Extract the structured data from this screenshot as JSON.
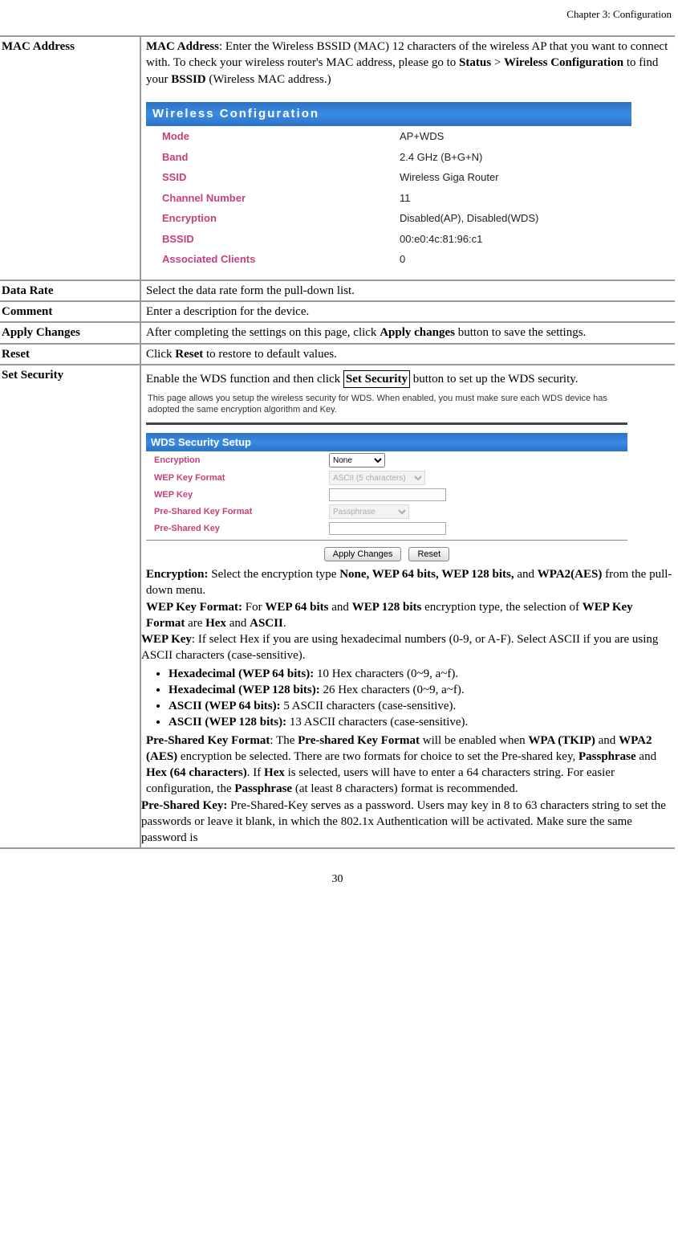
{
  "chapter": "Chapter 3: Configuration",
  "page_number": "30",
  "rows": {
    "mac_address": {
      "label": "MAC Address",
      "desc1a": "MAC Address",
      "desc1b": ": Enter the Wireless BSSID (MAC) 12 characters of the wireless AP that you want to connect with. To check your wireless router's MAC address, please go to ",
      "desc1c": "Status",
      "gt": " > ",
      "desc1d": "Wireless Configuration",
      "desc1e": " to find your ",
      "desc1f": "BSSID",
      "desc1g": " (Wireless MAC address.)"
    },
    "data_rate": {
      "label": "Data Rate",
      "desc": "Select the data rate form the pull-down list."
    },
    "comment": {
      "label": "Comment",
      "desc": "Enter a description for the device."
    },
    "apply": {
      "label": "Apply Changes",
      "desc_a": "After completing the settings on this page, click ",
      "desc_b": "Apply changes",
      "desc_c": " button to save the settings."
    },
    "reset": {
      "label": "Reset",
      "desc_a": "Click ",
      "desc_b": "Reset",
      "desc_c": " to restore to default values."
    },
    "set_sec": {
      "label": "Set Security",
      "desc_a": "Enable the WDS function and then click ",
      "desc_b": "Set Security",
      "desc_c": " button to set up the WDS security."
    }
  },
  "wireless_config": {
    "title": "Wireless  Configuration",
    "rows": [
      {
        "k": "Mode",
        "v": "AP+WDS"
      },
      {
        "k": "Band",
        "v": "2.4 GHz (B+G+N)"
      },
      {
        "k": "SSID",
        "v": "Wireless Giga Router"
      },
      {
        "k": "Channel Number",
        "v": "11"
      },
      {
        "k": "Encryption",
        "v": "Disabled(AP), Disabled(WDS)"
      },
      {
        "k": "BSSID",
        "v": "00:e0:4c:81:96:c1"
      },
      {
        "k": "Associated Clients",
        "v": "0"
      }
    ]
  },
  "wds": {
    "intro": "This page allows you setup the wireless security for WDS. When enabled, you must make sure each WDS device has adopted the same encryption algorithm and Key.",
    "header": "WDS Security Setup",
    "fields": {
      "encryption": {
        "label": "Encryption",
        "value": "None"
      },
      "wep_key_format": {
        "label": "WEP Key Format",
        "value": "ASCII (5 characters)"
      },
      "wep_key": {
        "label": "WEP Key",
        "value": ""
      },
      "psk_format": {
        "label": "Pre-Shared Key Format",
        "value": "Passphrase"
      },
      "psk": {
        "label": "Pre-Shared Key",
        "value": ""
      }
    },
    "buttons": {
      "apply": "Apply Changes",
      "reset": "Reset"
    }
  },
  "sec_body": {
    "enc_a": "Encryption:",
    "enc_b": " Select the encryption type ",
    "enc_c": "None, WEP 64 bits, WEP 128 bits,",
    "enc_d": " and ",
    "enc_e": "WPA2(AES)",
    "enc_f": " from the pull-down menu.",
    "wkf_a": "WEP Key Format:",
    "wkf_b": " For ",
    "wkf_c": "WEP 64 bits",
    "wkf_d": " and ",
    "wkf_e": "WEP 128 bits",
    "wkf_f": " encryption type, the selection of ",
    "wkf_g": "WEP Key Format",
    "wkf_h": " are ",
    "wkf_i": "Hex",
    "wkf_j": " and ",
    "wkf_k": "ASCII",
    "wkf_l": ".",
    "wk_a": "WEP Key",
    "wk_b": ": If select Hex if you are using hexadecimal numbers (0-9, or A-F). Select ASCII if you are using ASCII characters (case-sensitive).",
    "bul1_a": "Hexadecimal (WEP 64 bits):",
    "bul1_b": " 10 Hex characters (0~9, a~f).",
    "bul2_a": "Hexadecimal (WEP 128 bits):",
    "bul2_b": " 26 Hex characters (0~9, a~f).",
    "bul3_a": "ASCII (WEP 64 bits):",
    "bul3_b": " 5 ASCII characters (case-sensitive).",
    "bul4_a": "ASCII (WEP 128 bits):",
    "bul4_b": " 13 ASCII characters (case-sensitive).",
    "pskf_a": "Pre-Shared Key Format",
    "pskf_b": ": The ",
    "pskf_c": "Pre-shared Key Format",
    "pskf_d": " will be enabled when ",
    "pskf_e": "WPA (TKIP)",
    "pskf_f": " and ",
    "pskf_g": "WPA2 (AES)",
    "pskf_h": " encryption be selected. There are two formats for choice to set the Pre-shared key, ",
    "pskf_i": "Passphrase",
    "pskf_j": " and ",
    "pskf_k": "Hex (64 characters)",
    "pskf_l": ". If ",
    "pskf_m": "Hex",
    "pskf_n": " is selected, users will have to enter a 64 characters string. For easier configuration, the ",
    "pskf_o": "Passphrase",
    "pskf_p": " (at least 8 characters) format is recommended.",
    "psk_a": "Pre-Shared Key:",
    "psk_b": " Pre-Shared-Key serves as a password. Users may key in 8 to 63 characters string to set the passwords or leave it blank, in which the 802.1x Authentication will be activated.  Make sure the same password is"
  }
}
